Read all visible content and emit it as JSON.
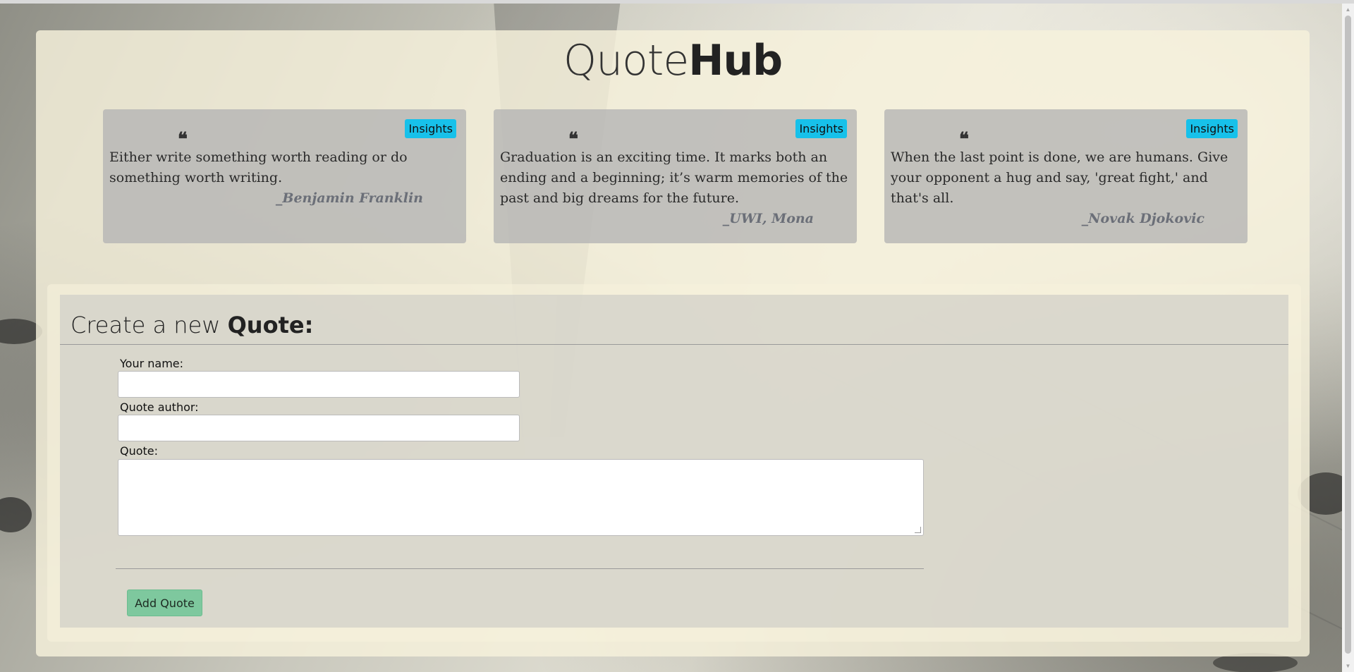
{
  "app": {
    "logo_light": "Quote",
    "logo_bold": "Hub"
  },
  "cards": [
    {
      "badge": "Insights",
      "quote_mark": "❝",
      "text": "Either write something worth reading or do something worth writing.",
      "author": "_Benjamin Franklin"
    },
    {
      "badge": "Insights",
      "quote_mark": "❝",
      "text": "Graduation is an exciting time. It marks both an ending and a beginning; it’s warm memories of the past and big dreams for the future.",
      "author": "_UWI, Mona"
    },
    {
      "badge": "Insights",
      "quote_mark": "❝",
      "text": "When the last point is done, we are humans. Give your opponent a hug and say, 'great fight,' and that's all.",
      "author": "_Novak Djokovic"
    }
  ],
  "form": {
    "title_light": "Create a new ",
    "title_bold": "Quote:",
    "name_label": "Your name:",
    "name_value": "",
    "author_label": "Quote author:",
    "author_value": "",
    "quote_label": "Quote:",
    "quote_value": "",
    "submit_label": "Add Quote"
  },
  "colors": {
    "insights_badge": "#17c1ea",
    "submit_button": "#7ec89e"
  }
}
